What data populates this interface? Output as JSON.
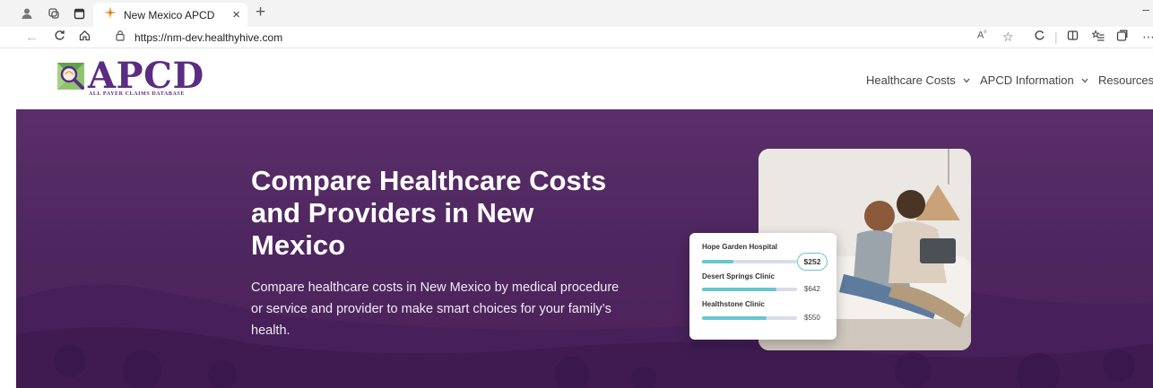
{
  "browser": {
    "tab_title": "New Mexico APCD",
    "tab_close": "×",
    "new_tab": "+",
    "url": "https://nm-dev.healthyhive.com"
  },
  "site": {
    "logo_text": "APCD",
    "logo_subtitle": "ALL PAYER CLAIMS DATABASE",
    "nav": [
      {
        "label": "Healthcare Costs"
      },
      {
        "label": "APCD Information"
      },
      {
        "label": "Resources"
      }
    ]
  },
  "hero": {
    "title": "Compare Healthcare Costs and Providers in New Mexico",
    "description": "Compare healthcare costs in New Mexico by medical procedure or service and provider to make smart choices for your family’s health."
  },
  "cost_card": {
    "items": [
      {
        "name": "Hope Garden Hospital",
        "price": "$252",
        "fill_fraction": 0.33,
        "highlighted": true
      },
      {
        "name": "Desert Springs Clinic",
        "price": "$642",
        "fill_fraction": 0.78,
        "highlighted": false
      },
      {
        "name": "Healthstone Clinic",
        "price": "$550",
        "fill_fraction": 0.68,
        "highlighted": false
      }
    ]
  },
  "colors": {
    "brand_purple": "#5a2d82",
    "hero_purple": "#4f2760",
    "accent_teal": "#67c6d0"
  },
  "icons": {
    "tab_favicon": "apcd-sparkle-icon",
    "browser_right": [
      "read-aloud-icon",
      "favorite-star-icon",
      "refresh-icon",
      "split-screen-icon",
      "favorites-list-icon",
      "collections-icon"
    ]
  }
}
